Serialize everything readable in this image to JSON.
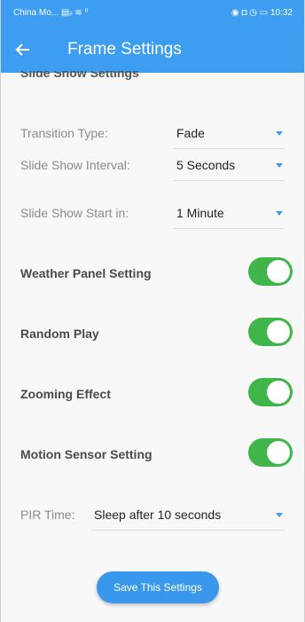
{
  "colors": {
    "appbar": "#3d9df0",
    "toggle_on": "#3fb54a",
    "save_button": "#3a98ec"
  },
  "status_bar": {
    "carrier": "China Mo...",
    "signal_text": "▤ᵢₗ ≋ ⁰",
    "right_icons": "◉ ◘ ◷ ▭",
    "time": "10:32"
  },
  "app_bar": {
    "title": "Frame Settings",
    "back_icon": "arrow-left-icon"
  },
  "section_title": "Slide Show Settings",
  "settings": {
    "transition": {
      "label": "Transition Type:",
      "value": "Fade"
    },
    "interval": {
      "label": "Slide Show Interval:",
      "value": "5 Seconds"
    },
    "start": {
      "label": "Slide Show Start in:",
      "value": "1 Minute"
    }
  },
  "toggles": {
    "weather": {
      "label": "Weather Panel Setting",
      "on": true
    },
    "random": {
      "label": "Random Play",
      "on": true
    },
    "zoom": {
      "label": "Zooming Effect",
      "on": true
    },
    "motion": {
      "label": "Motion Sensor Setting",
      "on": true
    }
  },
  "pir": {
    "label": "PIR Time:",
    "value": "Sleep after 10 seconds"
  },
  "save_label": "Save This Settings"
}
